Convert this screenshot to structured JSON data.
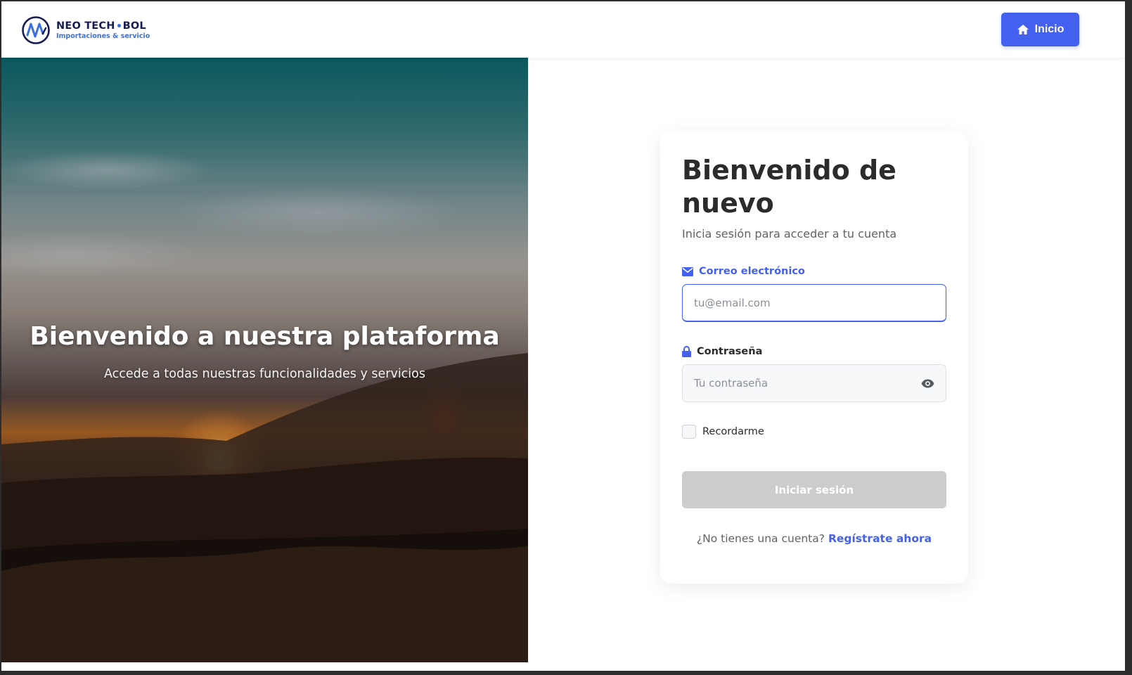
{
  "brand": {
    "name_part1": "NEO TECH",
    "name_part2": "BOL",
    "tagline": "Importaciones & servicio"
  },
  "nav": {
    "home_button_label": "Inicio",
    "home_icon": "home-icon"
  },
  "hero": {
    "title": "Bienvenido a nuestra plataforma",
    "subtitle": "Accede a todas nuestras funcionalidades y servicios"
  },
  "login": {
    "title": "Bienvenido de nuevo",
    "subtitle": "Inicia sesión para acceder a tu cuenta",
    "email_label": "Correo electrónico",
    "email_icon": "envelope-icon",
    "email_placeholder": "tu@email.com",
    "email_value": "",
    "password_label": "Contraseña",
    "password_icon": "lock-icon",
    "password_placeholder": "Tu contraseña",
    "password_value": "",
    "toggle_icon": "eye-icon",
    "remember_label": "Recordarme",
    "remember_checked": false,
    "submit_label": "Iniciar sesión",
    "signup_prompt": "¿No tienes una cuenta?",
    "signup_link": "Regístrate ahora"
  },
  "colors": {
    "accent": "#4361ee",
    "brand_navy": "#141c52",
    "button_disabled": "#cccccc",
    "text_dark": "#2b2b2b",
    "text_muted": "#5f6368"
  }
}
